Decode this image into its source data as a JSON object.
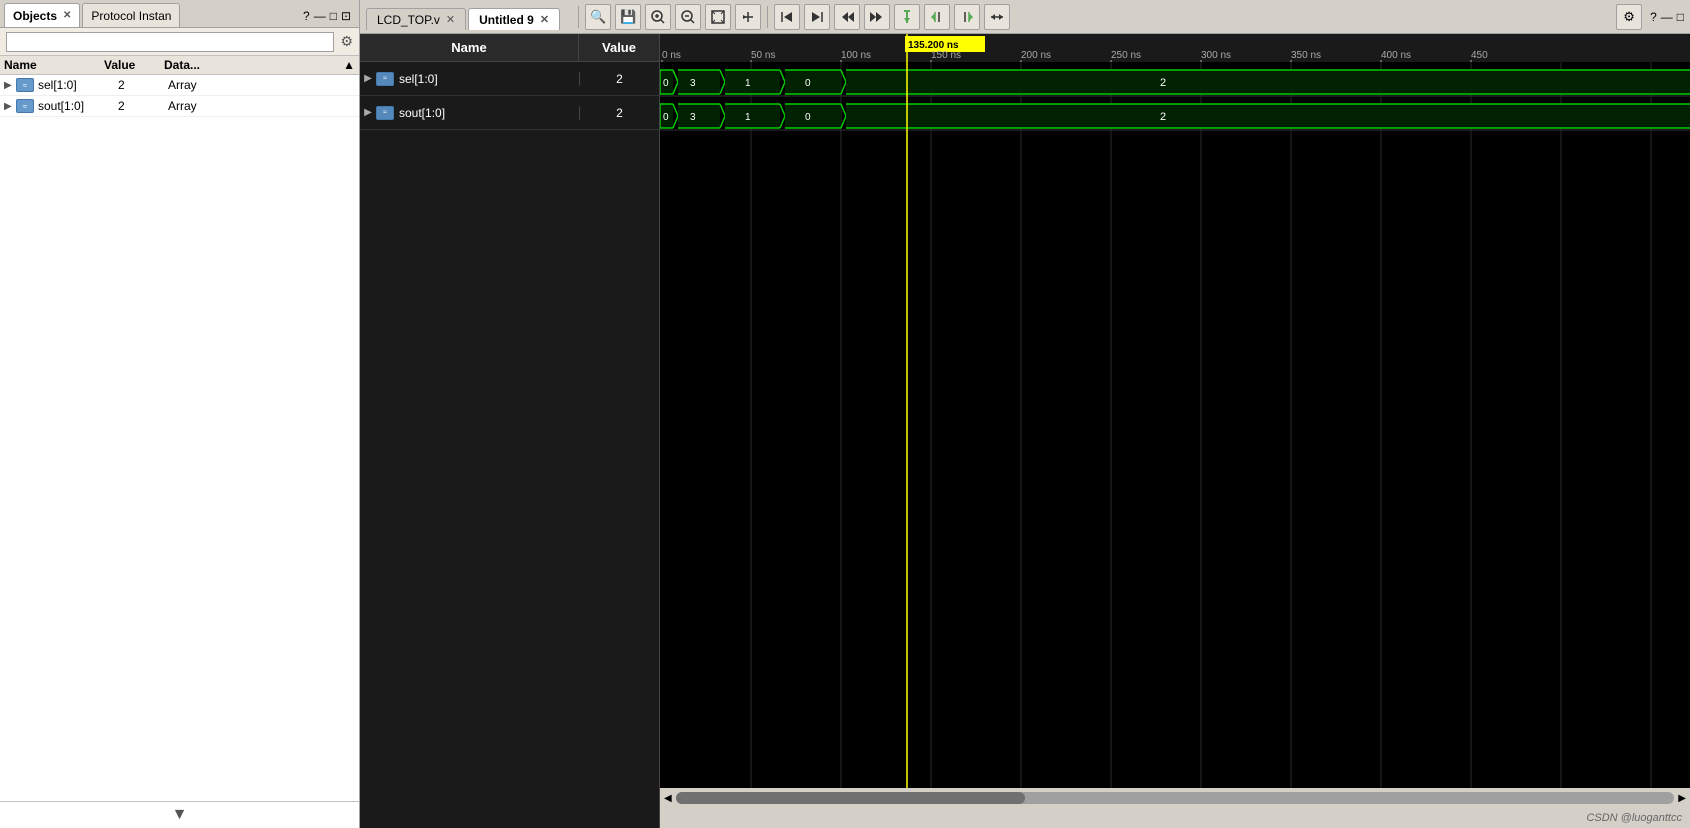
{
  "left_panel": {
    "tabs": [
      {
        "label": "Objects",
        "active": true
      },
      {
        "label": "Protocol Instan",
        "active": false
      }
    ],
    "tab_controls": [
      "?",
      "—",
      "□",
      "⊡"
    ],
    "search_placeholder": "",
    "table_headers": [
      "Name",
      "Value",
      "Data..."
    ],
    "rows": [
      {
        "name": "sel[1:0]",
        "value": "2",
        "data": "Array"
      },
      {
        "name": "sout[1:0]",
        "value": "2",
        "data": "Array"
      }
    ]
  },
  "right_panel": {
    "tabs": [
      {
        "label": "LCD_TOP.v",
        "active": false
      },
      {
        "label": "Untitled 9",
        "active": true
      }
    ],
    "toolbar_buttons": [
      {
        "icon": "🔍",
        "name": "search"
      },
      {
        "icon": "💾",
        "name": "save"
      },
      {
        "icon": "🔎+",
        "name": "zoom-in"
      },
      {
        "icon": "🔎-",
        "name": "zoom-out"
      },
      {
        "icon": "⤢",
        "name": "fit"
      },
      {
        "icon": "⟵",
        "name": "back"
      },
      {
        "icon": "|◀",
        "name": "first"
      },
      {
        "icon": "▶|",
        "name": "last"
      },
      {
        "icon": "⇤",
        "name": "prev-edge"
      },
      {
        "icon": "⇥",
        "name": "next-edge"
      },
      {
        "icon": "✚",
        "name": "add-marker"
      },
      {
        "icon": "↩",
        "name": "prev-marker"
      },
      {
        "icon": "↪",
        "name": "next-marker"
      },
      {
        "icon": "↔",
        "name": "stretch"
      }
    ],
    "waveform": {
      "cursor_time": "135.200 ns",
      "cursor_x_percent": 28.5,
      "timeline_ticks": [
        {
          "label": "0 ns",
          "pct": 0
        },
        {
          "label": "50 ns",
          "pct": 10.5
        },
        {
          "label": "100 ns",
          "pct": 21
        },
        {
          "label": "150 ns",
          "pct": 31.5
        },
        {
          "label": "200 ns",
          "pct": 42
        },
        {
          "label": "250 ns",
          "pct": 52.5
        },
        {
          "label": "300 ns",
          "pct": 63
        },
        {
          "label": "350 ns",
          "pct": 73.5
        },
        {
          "label": "400 ns",
          "pct": 84
        },
        {
          "label": "450",
          "pct": 94.5
        }
      ],
      "signals": [
        {
          "name": "sel[1:0]",
          "value": "2",
          "segments": [
            {
              "type": "bus",
              "x1_pct": 0,
              "x2_pct": 1.5,
              "label": "0"
            },
            {
              "type": "bus",
              "x1_pct": 1.5,
              "x2_pct": 7,
              "label": "3"
            },
            {
              "type": "bus",
              "x1_pct": 7,
              "x2_pct": 14,
              "label": "1"
            },
            {
              "type": "bus",
              "x1_pct": 14,
              "x2_pct": 21,
              "label": "0"
            },
            {
              "type": "bus",
              "x1_pct": 21,
              "x2_pct": 100,
              "label": "2"
            }
          ]
        },
        {
          "name": "sout[1:0]",
          "value": "2",
          "segments": [
            {
              "type": "bus",
              "x1_pct": 0,
              "x2_pct": 1.5,
              "label": "0"
            },
            {
              "type": "bus",
              "x1_pct": 1.5,
              "x2_pct": 7,
              "label": "3"
            },
            {
              "type": "bus",
              "x1_pct": 7,
              "x2_pct": 14,
              "label": "1"
            },
            {
              "type": "bus",
              "x1_pct": 14,
              "x2_pct": 21,
              "label": "0"
            },
            {
              "type": "bus",
              "x1_pct": 21,
              "x2_pct": 100,
              "label": "2"
            }
          ]
        }
      ]
    }
  },
  "watermark": "CSDN @luoganttcc"
}
